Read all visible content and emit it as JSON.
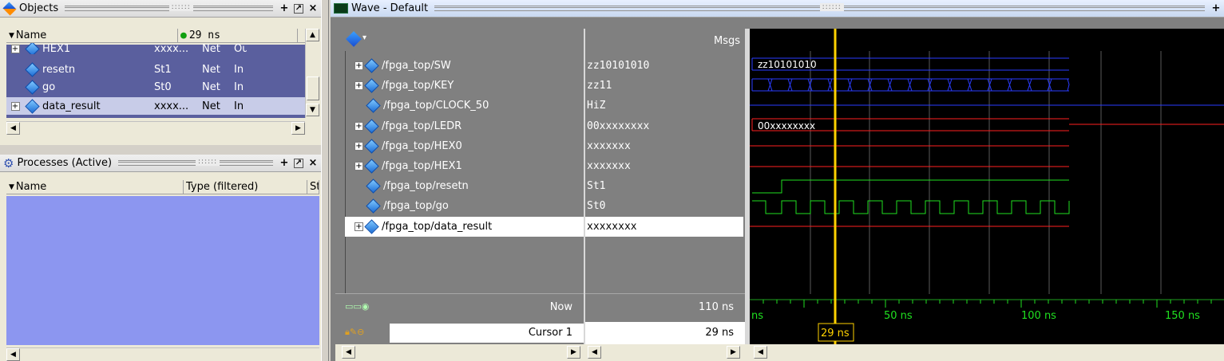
{
  "objects": {
    "title": "Objects",
    "col_name": "Name",
    "toolbar_time": "29 ns",
    "rows": [
      {
        "name": "HEX1",
        "value": "xxxx...",
        "kind": "Net",
        "mode": "Ou",
        "expandable": true
      },
      {
        "name": "resetn",
        "value": "St1",
        "kind": "Net",
        "mode": "In",
        "expandable": false
      },
      {
        "name": "go",
        "value": "St0",
        "kind": "Net",
        "mode": "In",
        "expandable": false
      },
      {
        "name": "data_result",
        "value": "xxxx...",
        "kind": "Net",
        "mode": "In",
        "expandable": true
      }
    ]
  },
  "processes": {
    "title": "Processes (Active)",
    "col_name": "Name",
    "col_type": "Type (filtered)",
    "col_state": "St"
  },
  "wave": {
    "title": "Wave - Default",
    "msgs_header": "Msgs",
    "signals": [
      {
        "name": "/fpga_top/SW",
        "value": "zz10101010",
        "expandable": true
      },
      {
        "name": "/fpga_top/KEY",
        "value": "zz11",
        "expandable": true
      },
      {
        "name": "/fpga_top/CLOCK_50",
        "value": "HiZ",
        "expandable": false
      },
      {
        "name": "/fpga_top/LEDR",
        "value": "00xxxxxxxx",
        "expandable": true
      },
      {
        "name": "/fpga_top/HEX0",
        "value": "xxxxxxx",
        "expandable": true
      },
      {
        "name": "/fpga_top/HEX1",
        "value": "xxxxxxx",
        "expandable": true
      },
      {
        "name": "/fpga_top/resetn",
        "value": "St1",
        "expandable": false
      },
      {
        "name": "/fpga_top/go",
        "value": "St0",
        "expandable": false
      },
      {
        "name": "/fpga_top/data_result",
        "value": "xxxxxxxx",
        "expandable": true
      }
    ],
    "wave_labels": {
      "sw": "zz10101010",
      "ledr": "00xxxxxxxx"
    },
    "now_label": "Now",
    "now_value": "110 ns",
    "cursor_label": "Cursor 1",
    "cursor_value": "29 ns",
    "cursor_marker": "29 ns",
    "ticks": [
      "ns",
      "50 ns",
      "100 ns",
      "150 ns"
    ],
    "colors": {
      "bus": "#2a3cff",
      "x": "#ff2020",
      "logic": "#20e020",
      "cursor": "#ffd200",
      "background": "#000000",
      "selected": "#ffffff"
    }
  }
}
